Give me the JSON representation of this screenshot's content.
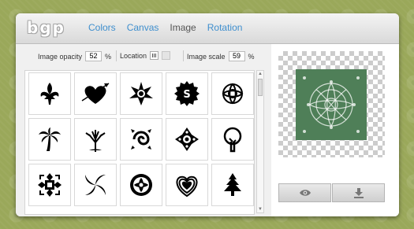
{
  "app": {
    "logo_text": "bgp"
  },
  "tabs": [
    {
      "label": "Colors",
      "active": false
    },
    {
      "label": "Canvas",
      "active": false
    },
    {
      "label": "Image",
      "active": true
    },
    {
      "label": "Rotation",
      "active": false
    }
  ],
  "controls": {
    "opacity_label": "Image opacity",
    "opacity_value": "52",
    "opacity_unit": "%",
    "location_label": "Location",
    "scale_label": "Image scale",
    "scale_value": "59",
    "scale_unit": "%"
  },
  "images": [
    [
      "fleur-de-lis-icon",
      "heart-arrow-icon",
      "star-burst-icon",
      "dollar-seal-icon",
      "celtic-knot-icon"
    ],
    [
      "palm-tree-icon",
      "oak-tree-icon",
      "swirl-ornament-icon",
      "flower-ornament-icon",
      "cartoon-tree-icon"
    ],
    [
      "damask-ornament-icon",
      "spiral-vortex-icon",
      "circular-damask-icon",
      "concentric-heart-icon",
      "pine-tree-icon"
    ]
  ],
  "preview": {
    "tile_color": "#4f7f58",
    "preview_button_icon": "eye-icon",
    "download_button_icon": "download-icon"
  },
  "colors": {
    "accent": "#3f8fce",
    "background": "#9aa85a"
  }
}
